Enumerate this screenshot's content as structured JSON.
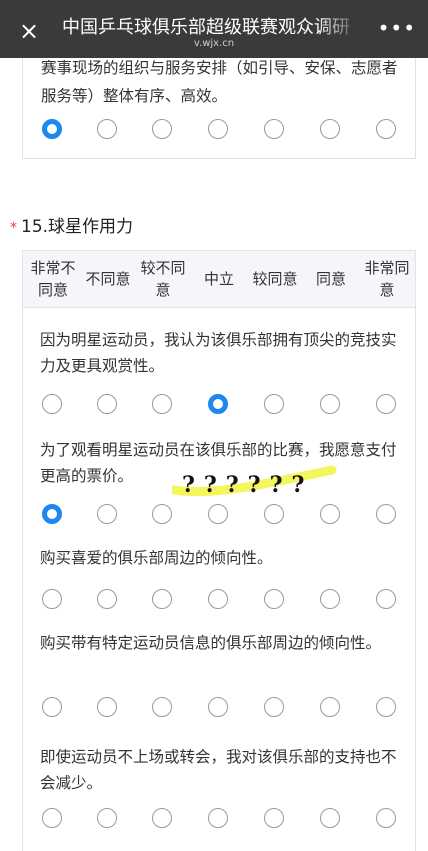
{
  "topbar": {
    "close_icon": "×",
    "title": "中国乒乓球俱乐部超级联赛观众调研",
    "subtitle": "v.wjx.cn",
    "more_icon": "•••"
  },
  "prev_question": {
    "text": "赛事现场的组织与服务安排（如引导、安保、志愿者服务等）整体有序、高效。",
    "selected_index": 0
  },
  "question": {
    "required_mark": "*",
    "title": "15.球星作用力",
    "scale": [
      "非常不同意",
      "不同意",
      "较不同意",
      "中立",
      "较同意",
      "同意",
      "非常同意"
    ],
    "rows": [
      {
        "text": "因为明星运动员，我认为该俱乐部拥有顶尖的竞技实力及更具观赏性。",
        "selected_index": 3
      },
      {
        "text": "为了观看明星运动员在该俱乐部的比赛，我愿意支付更高的票价。",
        "selected_index": 0
      },
      {
        "text": "购买喜爱的俱乐部周边的倾向性。",
        "selected_index": null
      },
      {
        "text": "购买带有特定运动员信息的俱乐部周边的倾向性。",
        "selected_index": null
      },
      {
        "text": "即使运动员不上场或转会，我对该俱乐部的支持也不会减少。",
        "selected_index": null
      }
    ]
  },
  "annotation": {
    "marks": "??????",
    "highlight_color": "#f2f542"
  },
  "accent_color": "#1e88f0"
}
